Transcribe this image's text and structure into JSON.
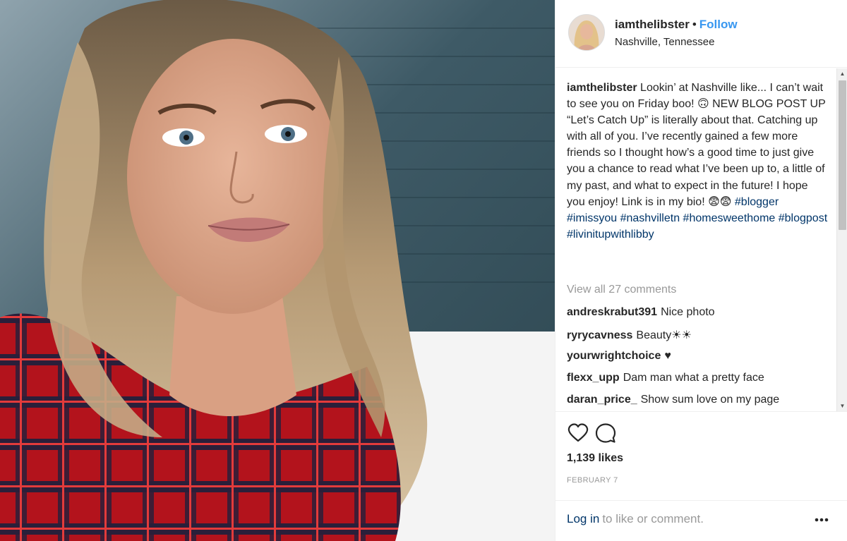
{
  "header": {
    "username": "iamthelibster",
    "separator": "•",
    "follow_label": "Follow",
    "location": "Nashville, Tennessee"
  },
  "caption": {
    "username": "iamthelibster",
    "text": "Lookin’ at Nashville like... I can’t wait to see you on Friday boo! 🙃 NEW BLOG POST UP “Let’s Catch Up” is literally about that. Catching up with all of you. I’ve recently gained a few more friends so I thought how’s a good time to just give you a chance to read what I’ve been up to, a little of my past, and what to expect in the future! I hope you enjoy! Link is in my bio! 😨😨",
    "hashtags": [
      "#blogger",
      "#imissyou",
      "#nashvilletn",
      "#homesweethome",
      "#blogpost",
      "#livinitupwithlibby"
    ]
  },
  "view_all_label": "View all 27 comments",
  "comments": [
    {
      "user": "andreskrabut391",
      "text": "Nice photo"
    },
    {
      "user": "ryrycavness",
      "text": "Beauty☀☀"
    },
    {
      "user": "yourwrightchoice",
      "text": "♥"
    },
    {
      "user": "flexx_upp",
      "text": "Dam man what a pretty face"
    },
    {
      "user": "daran_price_",
      "text": "Show sum love on my page"
    }
  ],
  "actions": {
    "like_icon": "heart-icon",
    "comment_icon": "comment-bubble-icon",
    "likes": "1,139 likes",
    "date": "FEBRUARY 7"
  },
  "footer": {
    "login_label": "Log in",
    "suffix": "to like or comment.",
    "more_icon": "more-options-icon"
  },
  "scroll": {
    "up_glyph": "▲",
    "down_glyph": "▼"
  },
  "colors": {
    "link_blue": "#3897f0",
    "hashtag": "#003569",
    "muted": "#999999",
    "text": "#262626"
  }
}
